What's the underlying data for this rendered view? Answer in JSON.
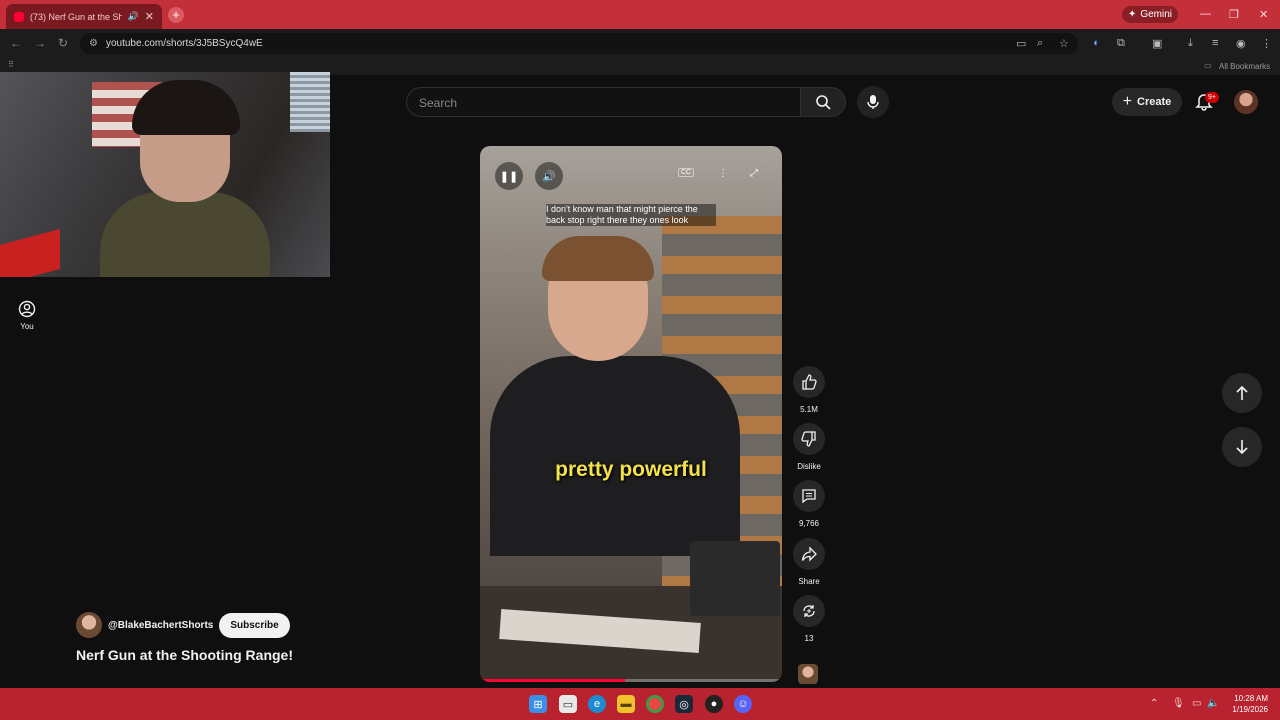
{
  "browser": {
    "tab_title": "(73) Nerf Gun at the Shooti...",
    "new_tab": "+",
    "gemini_label": "Gemini",
    "url": "youtube.com/shorts/3J5BSycQ4wE",
    "bookmarks_label": "All Bookmarks"
  },
  "youtube": {
    "search_placeholder": "Search",
    "create_label": "Create",
    "notif_badge": "9+",
    "sidebar_you": "You"
  },
  "video": {
    "caption_top": "I don't know man that might pierce the back stop right there they ones look",
    "caption_main": "pretty powerful",
    "progress": 0.48
  },
  "actions": {
    "like_count": "5.1M",
    "dislike_label": "Dislike",
    "comments_count": "9,766",
    "share_label": "Share",
    "remix_count": "13"
  },
  "channel": {
    "name": "@BlakeBachertShorts",
    "subscribe_label": "Subscribe",
    "video_title": "Nerf Gun at the Shooting Range!"
  },
  "taskbar": {
    "time": "10:28 AM",
    "date": "1/19/2026"
  },
  "colors": {
    "browser_frame": "#c4303a",
    "taskbar": "#b8232f",
    "youtube_bg": "#0f0f0f",
    "caption_yellow": "#f2e14a",
    "progress_red": "#ff0033"
  }
}
